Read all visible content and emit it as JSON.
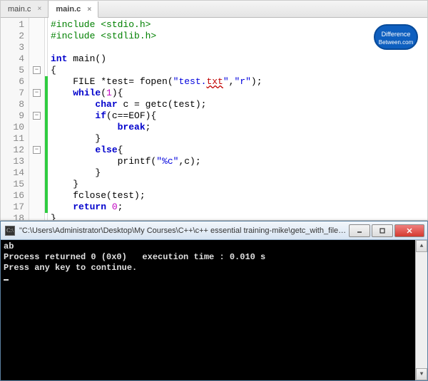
{
  "tabs": [
    {
      "label": "main.c",
      "active": false
    },
    {
      "label": "main.c",
      "active": true
    }
  ],
  "logo": {
    "line1": "Difference",
    "line2": "Between.com"
  },
  "code": {
    "lines": [
      {
        "n": 1,
        "pp": "#include <stdio.h>"
      },
      {
        "n": 2,
        "pp": "#include <stdlib.h>"
      },
      {
        "n": 3,
        "plain": ""
      },
      {
        "n": 4,
        "segs": [
          {
            "t": "int ",
            "c": "kw"
          },
          {
            "t": "main()",
            "c": "fn"
          }
        ]
      },
      {
        "n": 5,
        "plain": "{"
      },
      {
        "n": 6,
        "segs": [
          {
            "t": "    FILE *test= fopen(",
            "c": "fn"
          },
          {
            "t": "\"test.",
            "c": "str"
          },
          {
            "t": "txt",
            "c": "err"
          },
          {
            "t": "\"",
            "c": "str"
          },
          {
            "t": ",",
            "c": "fn"
          },
          {
            "t": "\"r\"",
            "c": "str"
          },
          {
            "t": ");",
            "c": "fn"
          }
        ]
      },
      {
        "n": 7,
        "segs": [
          {
            "t": "    ",
            "c": "fn"
          },
          {
            "t": "while",
            "c": "kw"
          },
          {
            "t": "(",
            "c": "fn"
          },
          {
            "t": "1",
            "c": "num"
          },
          {
            "t": "){",
            "c": "fn"
          }
        ]
      },
      {
        "n": 8,
        "segs": [
          {
            "t": "        ",
            "c": "fn"
          },
          {
            "t": "char",
            "c": "kw"
          },
          {
            "t": " c = getc(test);",
            "c": "fn"
          }
        ]
      },
      {
        "n": 9,
        "segs": [
          {
            "t": "        ",
            "c": "fn"
          },
          {
            "t": "if",
            "c": "kw"
          },
          {
            "t": "(c==EOF){",
            "c": "fn"
          }
        ]
      },
      {
        "n": 10,
        "segs": [
          {
            "t": "            ",
            "c": "fn"
          },
          {
            "t": "break",
            "c": "kw"
          },
          {
            "t": ";",
            "c": "fn"
          }
        ]
      },
      {
        "n": 11,
        "plain": "        }"
      },
      {
        "n": 12,
        "segs": [
          {
            "t": "        ",
            "c": "fn"
          },
          {
            "t": "else",
            "c": "kw"
          },
          {
            "t": "{",
            "c": "fn"
          }
        ]
      },
      {
        "n": 13,
        "segs": [
          {
            "t": "            printf(",
            "c": "fn"
          },
          {
            "t": "\"%c\"",
            "c": "str"
          },
          {
            "t": ",c);",
            "c": "fn"
          }
        ]
      },
      {
        "n": 14,
        "plain": "        }"
      },
      {
        "n": 15,
        "plain": "    }"
      },
      {
        "n": 16,
        "plain": "    fclose(test);"
      },
      {
        "n": 17,
        "segs": [
          {
            "t": "    ",
            "c": "fn"
          },
          {
            "t": "return",
            "c": "kw"
          },
          {
            "t": " ",
            "c": "fn"
          },
          {
            "t": "0",
            "c": "num"
          },
          {
            "t": ";",
            "c": "fn"
          }
        ]
      },
      {
        "n": 18,
        "plain": "}"
      }
    ],
    "folds": [
      5,
      7,
      9,
      12
    ],
    "change_range": [
      6,
      17
    ]
  },
  "console": {
    "title": "\"C:\\Users\\Administrator\\Desktop\\My Courses\\C++\\c++ essential training-mike\\getc_with_files_m...",
    "icon_glyph": "C:\\",
    "lines": [
      "ab",
      "Process returned 0 (0x0)   execution time : 0.010 s",
      "Press any key to continue."
    ]
  }
}
